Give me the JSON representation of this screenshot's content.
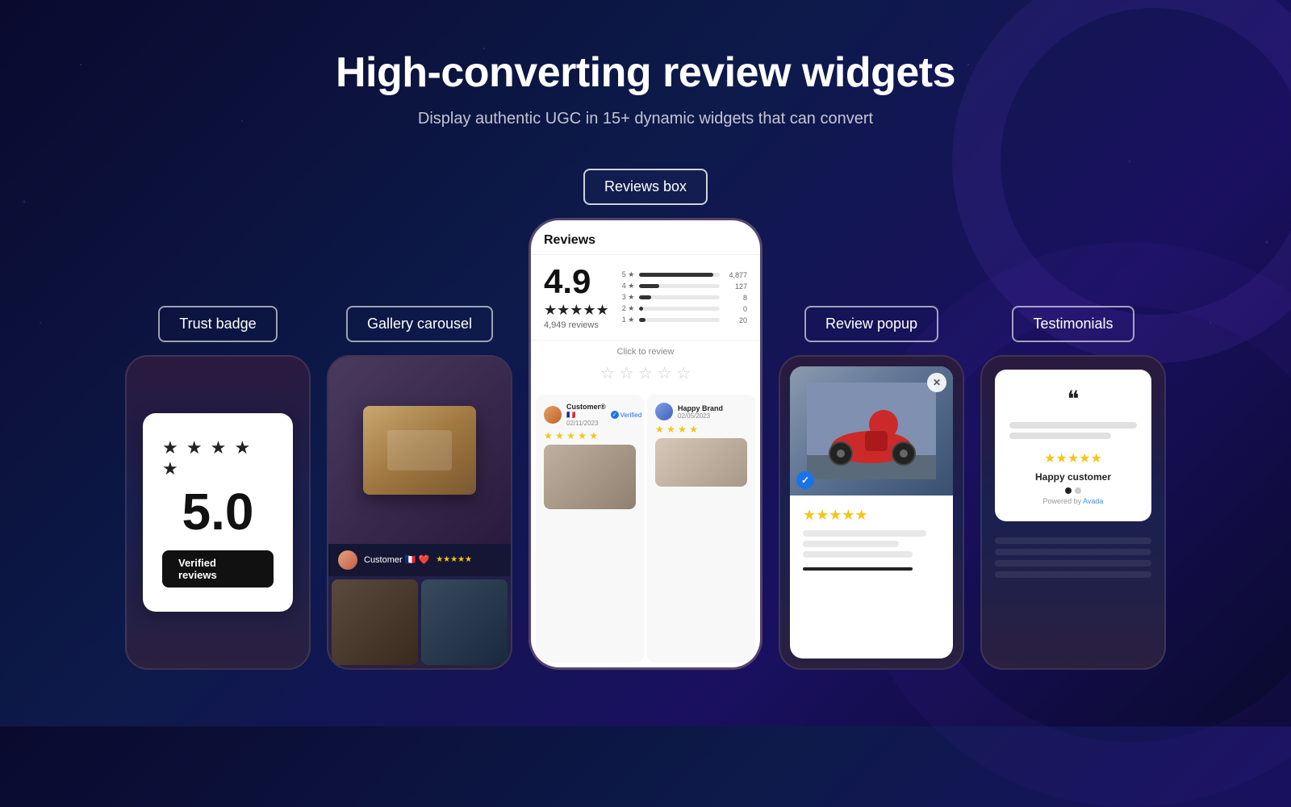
{
  "header": {
    "title": "High-converting review widgets",
    "subtitle": "Display authentic UGC in 15+ dynamic widgets that can convert"
  },
  "widgets": [
    {
      "id": "trust-badge",
      "label": "Trust badge",
      "score": "5.0",
      "stars": "★  ★  ★  ★  ★",
      "verified_text": "Verified reviews",
      "active": false
    },
    {
      "id": "gallery-carousel",
      "label": "Gallery carousel",
      "reviewer_name": "Customer 🇫🇷 ❤️",
      "stars": "★★★★★",
      "active": false
    },
    {
      "id": "reviews-box",
      "label": "Reviews box",
      "header": "Reviews",
      "score": "4.9",
      "stars": "★★★★★",
      "count": "4,949 reviews",
      "bars": [
        {
          "label": "5 ★",
          "pct": 92,
          "count": "4,877"
        },
        {
          "label": "4 ★",
          "pct": 25,
          "count": "127"
        },
        {
          "label": "3 ★",
          "pct": 5,
          "count": "8"
        },
        {
          "label": "2 ★",
          "pct": 2,
          "count": "0"
        },
        {
          "label": "1 ★",
          "pct": 8,
          "count": "20"
        }
      ],
      "click_to_review": "Click to review",
      "reviewer1_name": "Customer® 🇫🇷",
      "reviewer1_date": "02/11/2023",
      "reviewer1_verified": "Verified",
      "reviewer2_name": "Happy Brand",
      "reviewer2_date": "02/05/2023",
      "active": true
    },
    {
      "id": "review-popup",
      "label": "Review popup",
      "stars": "★★★★★",
      "active": false
    },
    {
      "id": "testimonials",
      "label": "Testimonials",
      "stars": "★★★★★",
      "customer_name": "Happy customer",
      "quote_icon": "❝",
      "powered_by": "Powered by ",
      "powered_brand": "Avada",
      "active": false
    }
  ],
  "dots": [
    {
      "top": "35%",
      "left": "3%"
    },
    {
      "top": "55%",
      "left": "6%"
    },
    {
      "top": "75%",
      "left": "2%"
    },
    {
      "top": "30%",
      "left": "93%"
    },
    {
      "top": "60%",
      "left": "96%"
    },
    {
      "top": "80%",
      "left": "91%"
    },
    {
      "top": "20%",
      "left": "50%"
    },
    {
      "top": "85%",
      "left": "50%"
    }
  ]
}
